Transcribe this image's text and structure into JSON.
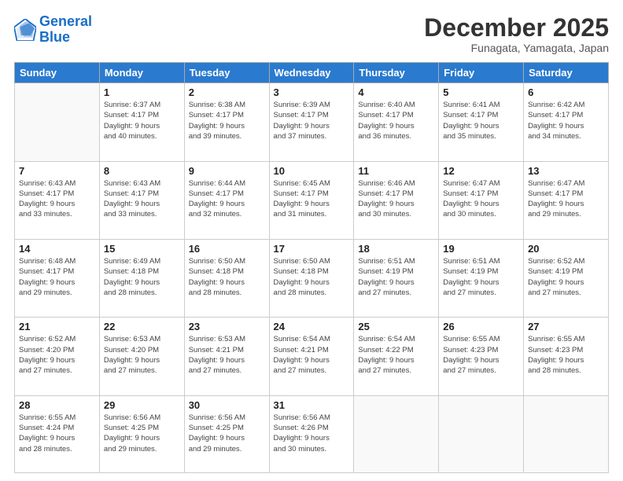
{
  "logo": {
    "line1": "General",
    "line2": "Blue"
  },
  "header": {
    "month": "December 2025",
    "location": "Funagata, Yamagata, Japan"
  },
  "weekdays": [
    "Sunday",
    "Monday",
    "Tuesday",
    "Wednesday",
    "Thursday",
    "Friday",
    "Saturday"
  ],
  "weeks": [
    [
      {
        "day": "",
        "info": ""
      },
      {
        "day": "1",
        "info": "Sunrise: 6:37 AM\nSunset: 4:17 PM\nDaylight: 9 hours\nand 40 minutes."
      },
      {
        "day": "2",
        "info": "Sunrise: 6:38 AM\nSunset: 4:17 PM\nDaylight: 9 hours\nand 39 minutes."
      },
      {
        "day": "3",
        "info": "Sunrise: 6:39 AM\nSunset: 4:17 PM\nDaylight: 9 hours\nand 37 minutes."
      },
      {
        "day": "4",
        "info": "Sunrise: 6:40 AM\nSunset: 4:17 PM\nDaylight: 9 hours\nand 36 minutes."
      },
      {
        "day": "5",
        "info": "Sunrise: 6:41 AM\nSunset: 4:17 PM\nDaylight: 9 hours\nand 35 minutes."
      },
      {
        "day": "6",
        "info": "Sunrise: 6:42 AM\nSunset: 4:17 PM\nDaylight: 9 hours\nand 34 minutes."
      }
    ],
    [
      {
        "day": "7",
        "info": "Sunrise: 6:43 AM\nSunset: 4:17 PM\nDaylight: 9 hours\nand 33 minutes."
      },
      {
        "day": "8",
        "info": "Sunrise: 6:43 AM\nSunset: 4:17 PM\nDaylight: 9 hours\nand 33 minutes."
      },
      {
        "day": "9",
        "info": "Sunrise: 6:44 AM\nSunset: 4:17 PM\nDaylight: 9 hours\nand 32 minutes."
      },
      {
        "day": "10",
        "info": "Sunrise: 6:45 AM\nSunset: 4:17 PM\nDaylight: 9 hours\nand 31 minutes."
      },
      {
        "day": "11",
        "info": "Sunrise: 6:46 AM\nSunset: 4:17 PM\nDaylight: 9 hours\nand 30 minutes."
      },
      {
        "day": "12",
        "info": "Sunrise: 6:47 AM\nSunset: 4:17 PM\nDaylight: 9 hours\nand 30 minutes."
      },
      {
        "day": "13",
        "info": "Sunrise: 6:47 AM\nSunset: 4:17 PM\nDaylight: 9 hours\nand 29 minutes."
      }
    ],
    [
      {
        "day": "14",
        "info": "Sunrise: 6:48 AM\nSunset: 4:17 PM\nDaylight: 9 hours\nand 29 minutes."
      },
      {
        "day": "15",
        "info": "Sunrise: 6:49 AM\nSunset: 4:18 PM\nDaylight: 9 hours\nand 28 minutes."
      },
      {
        "day": "16",
        "info": "Sunrise: 6:50 AM\nSunset: 4:18 PM\nDaylight: 9 hours\nand 28 minutes."
      },
      {
        "day": "17",
        "info": "Sunrise: 6:50 AM\nSunset: 4:18 PM\nDaylight: 9 hours\nand 28 minutes."
      },
      {
        "day": "18",
        "info": "Sunrise: 6:51 AM\nSunset: 4:19 PM\nDaylight: 9 hours\nand 27 minutes."
      },
      {
        "day": "19",
        "info": "Sunrise: 6:51 AM\nSunset: 4:19 PM\nDaylight: 9 hours\nand 27 minutes."
      },
      {
        "day": "20",
        "info": "Sunrise: 6:52 AM\nSunset: 4:19 PM\nDaylight: 9 hours\nand 27 minutes."
      }
    ],
    [
      {
        "day": "21",
        "info": "Sunrise: 6:52 AM\nSunset: 4:20 PM\nDaylight: 9 hours\nand 27 minutes."
      },
      {
        "day": "22",
        "info": "Sunrise: 6:53 AM\nSunset: 4:20 PM\nDaylight: 9 hours\nand 27 minutes."
      },
      {
        "day": "23",
        "info": "Sunrise: 6:53 AM\nSunset: 4:21 PM\nDaylight: 9 hours\nand 27 minutes."
      },
      {
        "day": "24",
        "info": "Sunrise: 6:54 AM\nSunset: 4:21 PM\nDaylight: 9 hours\nand 27 minutes."
      },
      {
        "day": "25",
        "info": "Sunrise: 6:54 AM\nSunset: 4:22 PM\nDaylight: 9 hours\nand 27 minutes."
      },
      {
        "day": "26",
        "info": "Sunrise: 6:55 AM\nSunset: 4:23 PM\nDaylight: 9 hours\nand 27 minutes."
      },
      {
        "day": "27",
        "info": "Sunrise: 6:55 AM\nSunset: 4:23 PM\nDaylight: 9 hours\nand 28 minutes."
      }
    ],
    [
      {
        "day": "28",
        "info": "Sunrise: 6:55 AM\nSunset: 4:24 PM\nDaylight: 9 hours\nand 28 minutes."
      },
      {
        "day": "29",
        "info": "Sunrise: 6:56 AM\nSunset: 4:25 PM\nDaylight: 9 hours\nand 29 minutes."
      },
      {
        "day": "30",
        "info": "Sunrise: 6:56 AM\nSunset: 4:25 PM\nDaylight: 9 hours\nand 29 minutes."
      },
      {
        "day": "31",
        "info": "Sunrise: 6:56 AM\nSunset: 4:26 PM\nDaylight: 9 hours\nand 30 minutes."
      },
      {
        "day": "",
        "info": ""
      },
      {
        "day": "",
        "info": ""
      },
      {
        "day": "",
        "info": ""
      }
    ]
  ]
}
